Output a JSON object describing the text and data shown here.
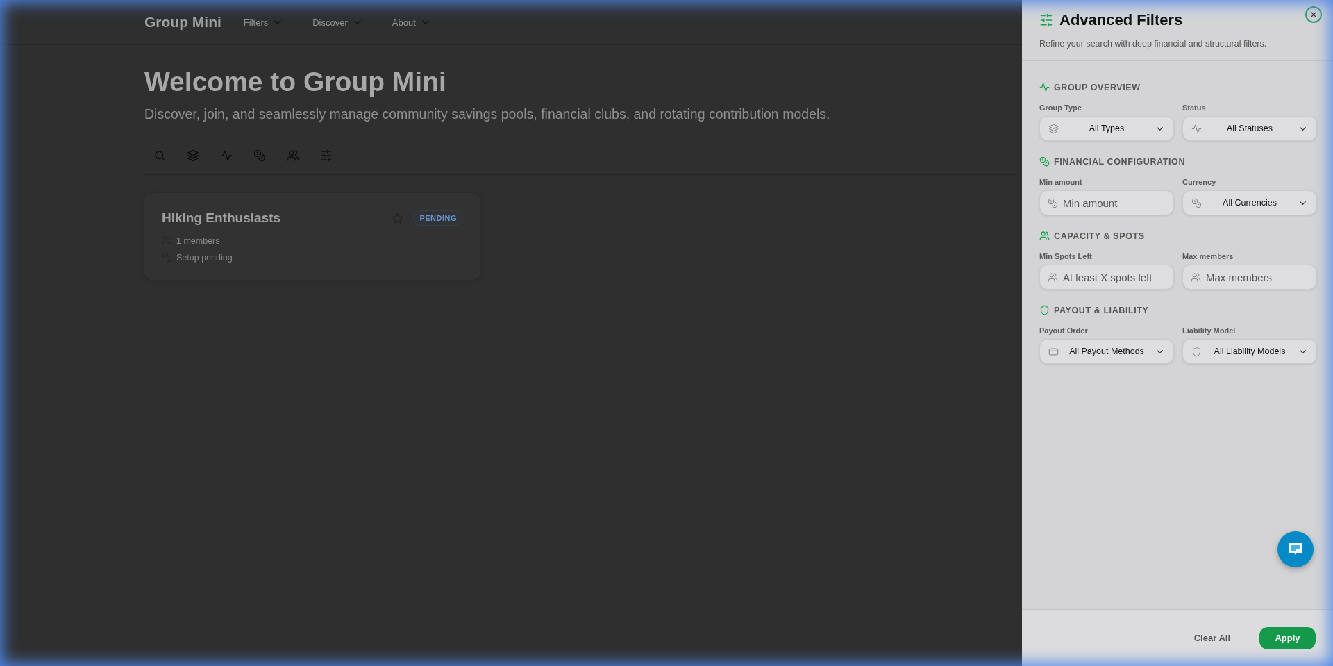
{
  "header": {
    "logo": "Group Mini",
    "nav": [
      {
        "label": "Filters"
      },
      {
        "label": "Discover"
      },
      {
        "label": "About"
      }
    ]
  },
  "hero": {
    "title": "Welcome to Group Mini",
    "subtitle": "Discover, join, and seamlessly manage community savings pools, financial clubs, and rotating contribution models."
  },
  "card": {
    "title": "Hiking Enthusiasts",
    "badge": "PENDING",
    "meta": [
      "1 members",
      "Setup pending"
    ]
  },
  "drawer": {
    "title": "Advanced Filters",
    "subtitle": "Refine your search with deep financial and structural filters.",
    "sections": [
      {
        "title": "GROUP OVERVIEW",
        "fields": [
          {
            "label": "Group Type",
            "kind": "select",
            "value": "All Types"
          },
          {
            "label": "Status",
            "kind": "select",
            "value": "All Statuses"
          }
        ]
      },
      {
        "title": "FINANCIAL CONFIGURATION",
        "fields": [
          {
            "label": "Min amount",
            "kind": "input",
            "placeholder": "Min amount"
          },
          {
            "label": "Currency",
            "kind": "select",
            "value": "All Currencies"
          }
        ]
      },
      {
        "title": "CAPACITY & SPOTS",
        "fields": [
          {
            "label": "Min Spots Left",
            "kind": "input",
            "placeholder": "At least X spots left"
          },
          {
            "label": "Max members",
            "kind": "input",
            "placeholder": "Max members"
          }
        ]
      },
      {
        "title": "PAYOUT & LIABILITY",
        "fields": [
          {
            "label": "Payout Order",
            "kind": "select",
            "value": "All Payout Methods"
          },
          {
            "label": "Liability Model",
            "kind": "select",
            "value": "All Liability Models"
          }
        ]
      }
    ],
    "buttons": {
      "clear": "Clear All",
      "apply": "Apply"
    }
  }
}
